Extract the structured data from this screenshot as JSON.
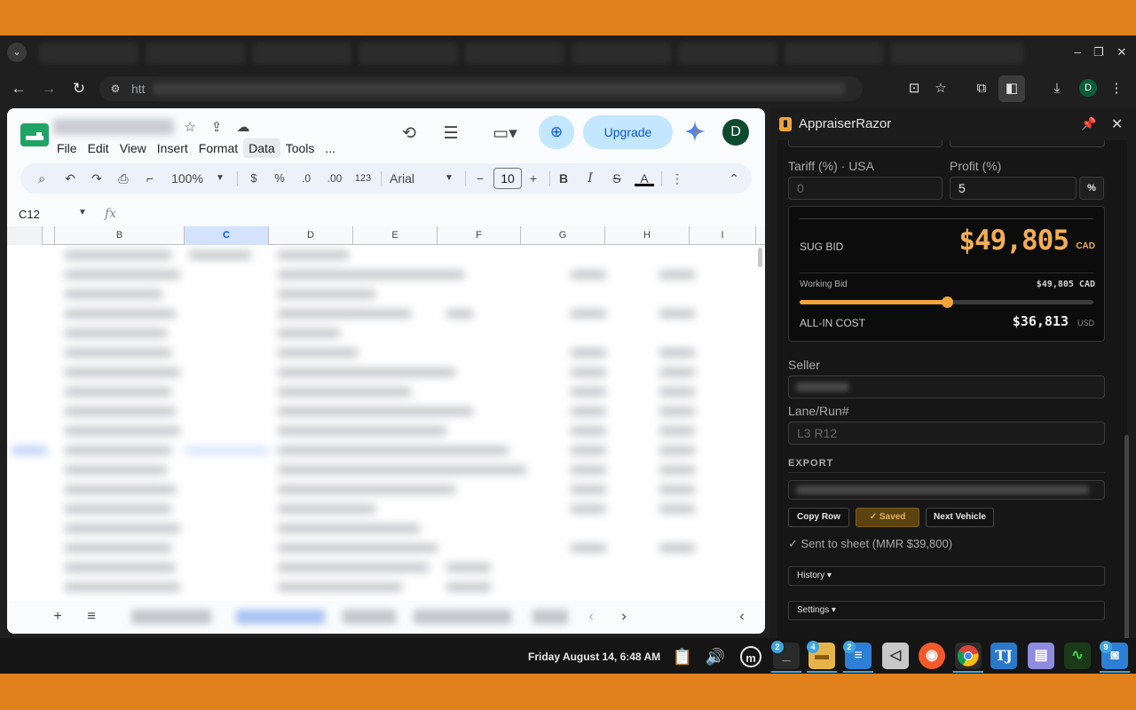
{
  "browser": {
    "address_prefix": "htt",
    "profile_initial": "D"
  },
  "sheets": {
    "menu": [
      "File",
      "Edit",
      "View",
      "Insert",
      "Format",
      "Data",
      "Tools",
      "..."
    ],
    "upgrade_label": "Upgrade",
    "user_initial": "D",
    "toolbar": {
      "zoom": "100%",
      "currency": "$",
      "percent": "%",
      "dec_decrease": ".0",
      "dec_increase": ".00",
      "number_format": "123",
      "font": "Arial",
      "font_size": "10"
    },
    "name_box": "C12",
    "fx_label": "fx",
    "columns": [
      "B",
      "C",
      "D",
      "E",
      "F",
      "G",
      "H",
      "I"
    ],
    "selected_column": "C"
  },
  "extension": {
    "title": "AppraiserRazor",
    "tariff_label": "Tariff (%) · USA",
    "tariff_placeholder": "0",
    "profit_label": "Profit (%)",
    "profit_value": "5",
    "percent_button": "%",
    "sug_bid_label": "SUG BID",
    "sug_bid_value": "$49,805",
    "sug_bid_currency": "CAD",
    "working_bid_label": "Working Bid",
    "working_bid_value": "$49,805 CAD",
    "working_bid_level": 0.5,
    "all_in_label": "ALL-IN COST",
    "all_in_value": "$36,813",
    "all_in_currency": "USD",
    "seller_label": "Seller",
    "lane_label": "Lane/Run#",
    "lane_placeholder": "L3 R12",
    "export_label": "EXPORT",
    "copy_row_label": "Copy Row",
    "saved_label": "✓ Saved",
    "next_vehicle_label": "Next Vehicle",
    "sent_message": "✓ Sent to sheet (MMR $39,800)",
    "history_label": "History ▾",
    "settings_label": "Settings ▾"
  },
  "taskbar": {
    "clock": "Friday August 14, 6:48 AM",
    "badges": {
      "terminal": "2",
      "files": "4",
      "text": "2",
      "camera": "9"
    }
  },
  "colors": {
    "desktop": "#e0811c",
    "accent_orange": "#f2a33a",
    "sheets_blue": "#c2e7ff"
  }
}
